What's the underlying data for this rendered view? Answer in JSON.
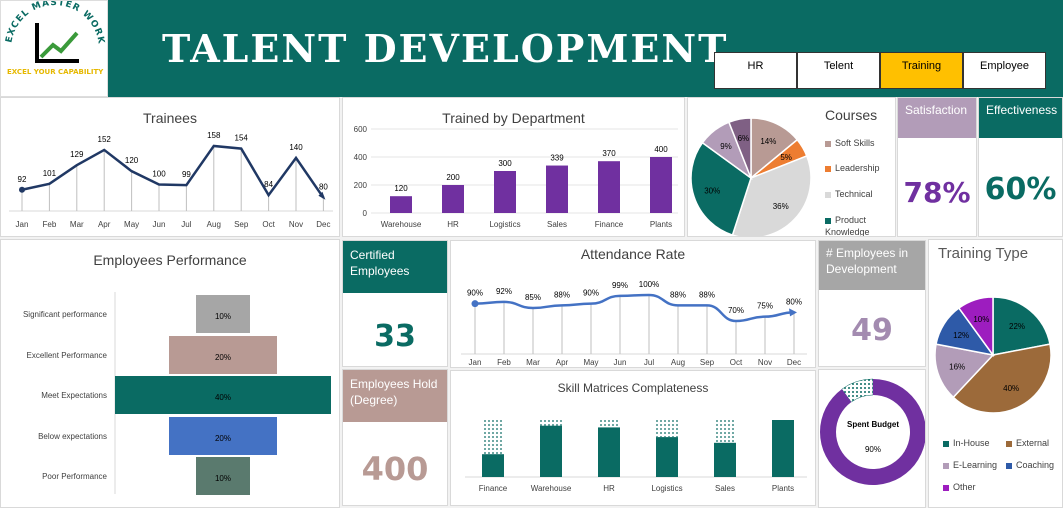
{
  "header": {
    "title": "TALENT DEVELOPMENT",
    "logo_text": "EXCEL MASTER WORK",
    "logo_tagline": "EXCEL YOUR CAPABILITY",
    "tabs": [
      {
        "label": "HR",
        "active": false
      },
      {
        "label": "Telent",
        "active": false
      },
      {
        "label": "Training",
        "active": true
      },
      {
        "label": "Employee",
        "active": false
      }
    ]
  },
  "colors": {
    "teal": "#0a6b63",
    "navy": "#203864",
    "purple": "#7030a0",
    "mauve": "#b29cb8",
    "tan": "#b89a94",
    "grey": "#a6a6a6",
    "blue": "#4472c4",
    "gold": "#ffc000"
  },
  "kpis": {
    "satisfaction": {
      "label": "Satisfaction",
      "value": "78%"
    },
    "effectiveness": {
      "label": "Effectiveness",
      "value": "60%"
    },
    "certified": {
      "label": "Certified Employees",
      "value": "33"
    },
    "holding_degree": {
      "label": "Employees Hold (Degree)",
      "value": "400"
    },
    "in_development": {
      "label": "# Employees in Development",
      "value": "49"
    }
  },
  "chart_data": [
    {
      "id": "trainees",
      "type": "line",
      "title": "Trainees",
      "categories": [
        "Jan",
        "Feb",
        "Mar",
        "Apr",
        "May",
        "Jun",
        "Jul",
        "Aug",
        "Sep",
        "Oct",
        "Nov",
        "Dec"
      ],
      "values": [
        92,
        101,
        129,
        152,
        120,
        100,
        99,
        158,
        154,
        84,
        140,
        80
      ],
      "grid": false
    },
    {
      "id": "trained_by_department",
      "type": "bar",
      "title": "Trained by Department",
      "categories": [
        "Warehouse",
        "HR",
        "Logistics",
        "Sales",
        "Finance",
        "Plants"
      ],
      "values": [
        120,
        200,
        300,
        339,
        370,
        400
      ],
      "ylim": [
        0,
        600
      ],
      "yticks": [
        0,
        200,
        400,
        600
      ],
      "grid": true
    },
    {
      "id": "courses",
      "type": "pie",
      "title": "Courses",
      "series": [
        {
          "name": "Soft Skills",
          "value": 14
        },
        {
          "name": "Leadership",
          "value": 5
        },
        {
          "name": "Technical",
          "value": 36
        },
        {
          "name": "Product Knowledge",
          "value": 30
        },
        {
          "name": "",
          "value": 9
        },
        {
          "name": "",
          "value": 6
        }
      ],
      "legend": "right"
    },
    {
      "id": "employees_performance",
      "type": "bar",
      "title": "Employees Performance",
      "categories": [
        "Significant performance",
        "Excellent Performance",
        "Meet Expectations",
        "Below expectations",
        "Poor Performance"
      ],
      "values": [
        10,
        20,
        40,
        20,
        10
      ],
      "value_labels": [
        "10%",
        "20%",
        "40%",
        "20%",
        "10%"
      ],
      "orientation": "horizontal-funnel"
    },
    {
      "id": "attendance_rate",
      "type": "line",
      "title": "Attendance Rate",
      "categories": [
        "Jan",
        "Feb",
        "Mar",
        "Apr",
        "May",
        "Jun",
        "Jul",
        "Aug",
        "Sep",
        "Oct",
        "Nov",
        "Dec"
      ],
      "values": [
        90,
        92,
        85,
        88,
        90,
        99,
        100,
        88,
        88,
        70,
        75,
        80
      ],
      "value_labels": [
        "90%",
        "92%",
        "85%",
        "88%",
        "90%",
        "99%",
        "100%",
        "88%",
        "88%",
        "70%",
        "75%",
        "80%"
      ]
    },
    {
      "id": "skill_matrices",
      "type": "bar",
      "title": "Skill Matrices Complateness",
      "categories": [
        "Finance",
        "Warehouse",
        "HR",
        "Logistics",
        "Sales",
        "Plants"
      ],
      "values": [
        40,
        90,
        87,
        70,
        60,
        100
      ],
      "stacked_remainder": true
    },
    {
      "id": "spent_budget",
      "type": "pie",
      "title": "Spent Budget",
      "values": [
        90,
        10
      ],
      "value_label": "90%",
      "style": "doughnut"
    },
    {
      "id": "training_type",
      "type": "pie",
      "title": "Training Type",
      "series": [
        {
          "name": "In-House",
          "value": 22,
          "label": "22%"
        },
        {
          "name": "External",
          "value": 40,
          "label": "40%"
        },
        {
          "name": "E-Learning",
          "value": 16,
          "label": "16%"
        },
        {
          "name": "Coaching",
          "value": 12,
          "label": "12%"
        },
        {
          "name": "Other",
          "value": 10,
          "label": "10%"
        }
      ],
      "legend": "bottom"
    }
  ]
}
